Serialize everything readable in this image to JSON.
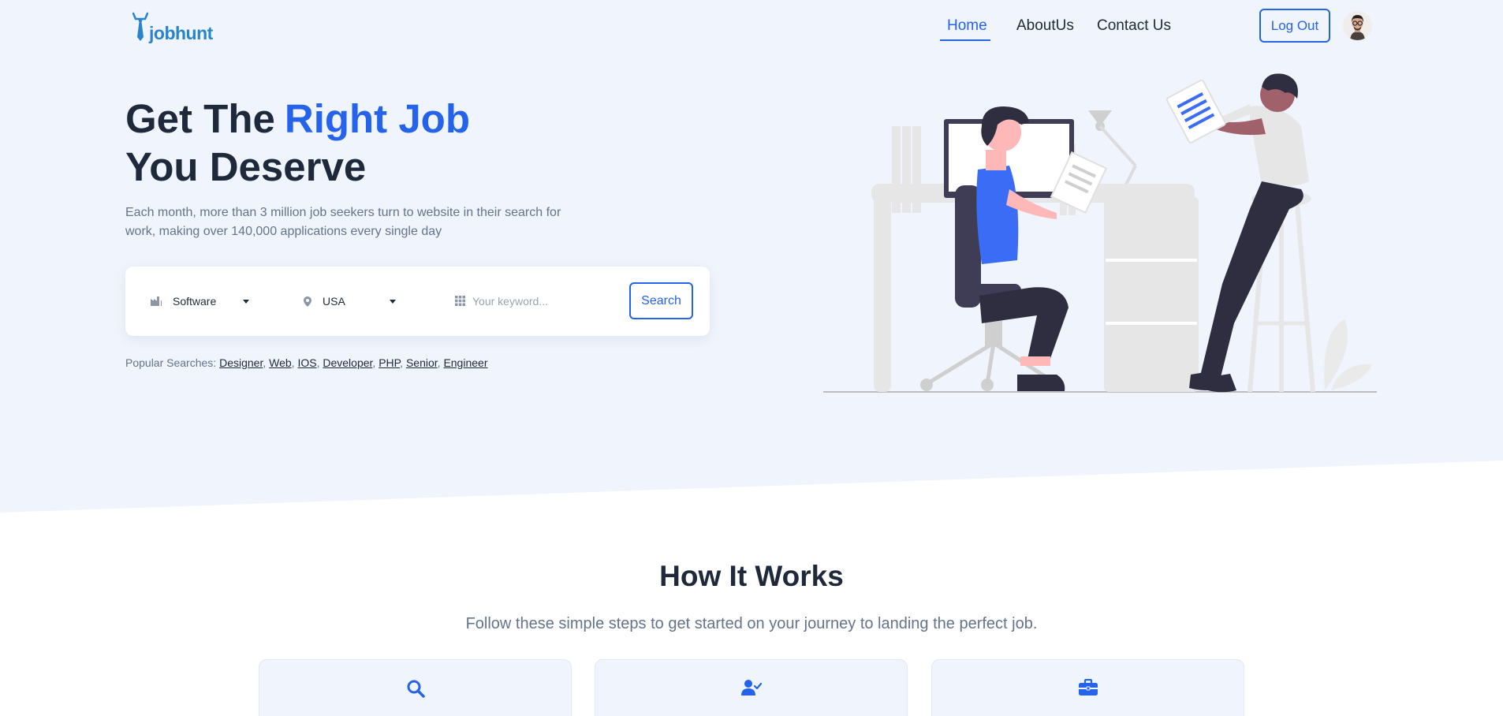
{
  "colors": {
    "accent": "#2563eb",
    "hero_bg": "#eff4fd",
    "logo": "#2a84c9"
  },
  "brand": {
    "name": "jobhunt",
    "icon": "tie-icon"
  },
  "nav": {
    "links": [
      {
        "label": "Home",
        "active": true
      },
      {
        "label": "AboutUs",
        "active": false
      },
      {
        "label": "Contact Us",
        "active": false
      }
    ],
    "logout_label": "Log Out",
    "avatar_icon": "user-avatar-icon"
  },
  "hero": {
    "title_part1": "Get The",
    "title_accent": "Right Job",
    "title_part2": "You Deserve",
    "description": "Each month, more than 3 million job seekers turn to website in their search for work, making over 140,000 applications every single day"
  },
  "search": {
    "category": {
      "value": "Software",
      "icon": "industry-icon"
    },
    "location": {
      "value": "USA",
      "icon": "map-pin-icon"
    },
    "keyword": {
      "value": "",
      "placeholder": "Your keyword...",
      "icon": "grid-icon"
    },
    "button_label": "Search"
  },
  "popular": {
    "label": "Popular Searches:",
    "items": [
      "Designer",
      "Web",
      "IOS",
      "Developer",
      "PHP",
      "Senior",
      "Engineer"
    ]
  },
  "how_it_works": {
    "title": "How It Works",
    "subtitle": "Follow these simple steps to get started on your journey to landing the perfect job.",
    "steps": [
      {
        "icon": "search-icon"
      },
      {
        "icon": "user-check-icon"
      },
      {
        "icon": "briefcase-icon"
      }
    ]
  }
}
